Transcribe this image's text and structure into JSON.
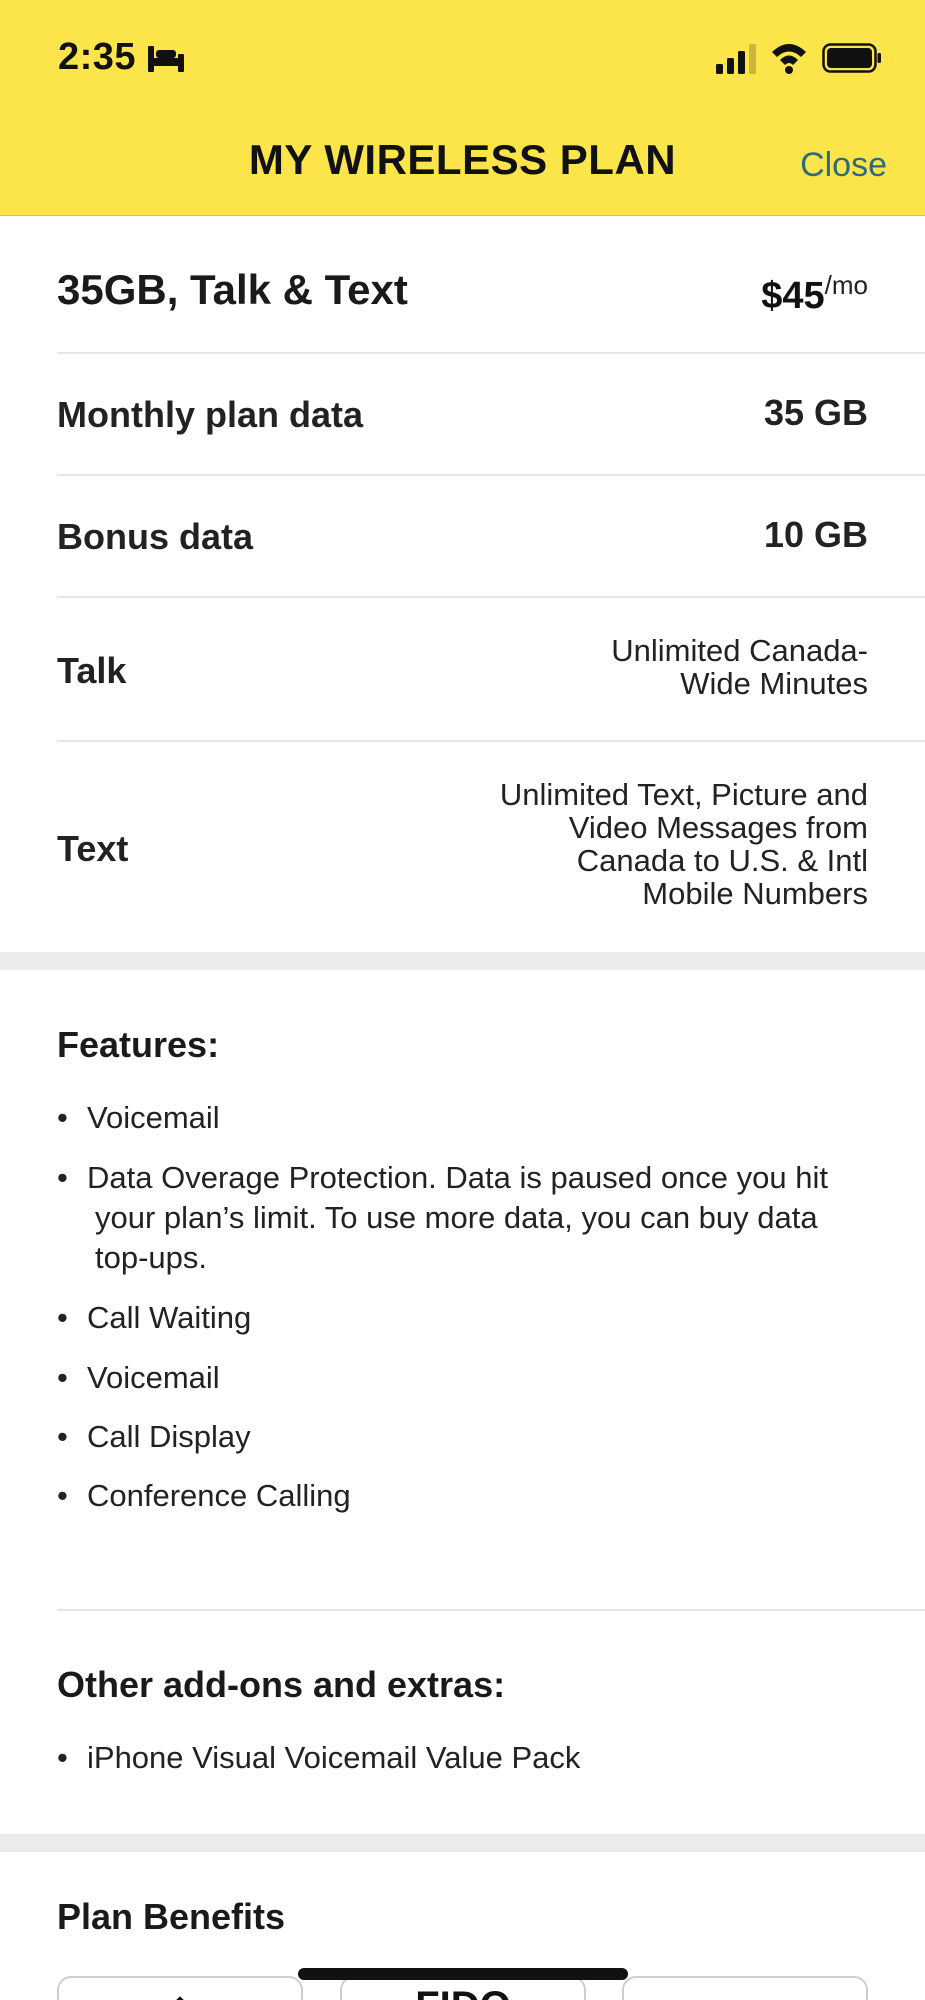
{
  "status_bar": {
    "time": "2:35"
  },
  "header": {
    "title": "MY WIRELESS PLAN",
    "close_label": "Close",
    "background_color": "#fbe54a",
    "accent_color": "#2e6b7a"
  },
  "plan": {
    "name": "35GB, Talk & Text",
    "price": "$45",
    "price_unit": "/mo",
    "rows": [
      {
        "label": "Monthly plan data",
        "value": "35 GB"
      },
      {
        "label": "Bonus data",
        "value": "10 GB"
      },
      {
        "label": "Talk",
        "value_lines": [
          "Unlimited Canada-",
          "Wide Minutes"
        ]
      },
      {
        "label": "Text",
        "value_lines": [
          "Unlimited Text, Picture and",
          "Video Messages from",
          "Canada to U.S. & Intl",
          "Mobile Numbers"
        ]
      }
    ]
  },
  "features": {
    "title": "Features:",
    "items": [
      "Voicemail",
      [
        "Data Overage Protection. Data is paused once you hit",
        "your plan’s limit. To use more data, you can buy data",
        "top-ups."
      ],
      "Call Waiting",
      "Voicemail",
      "Call Display",
      "Conference Calling"
    ]
  },
  "addons": {
    "title": "Other add-ons and extras:",
    "items": [
      "iPhone Visual Voicemail Value Pack"
    ]
  },
  "benefits": {
    "title": "Plan Benefits",
    "cards": [
      {
        "icon": "home-icon"
      },
      {
        "logo_text": "FIDO"
      },
      {
        "icon": ""
      }
    ]
  },
  "icons": {
    "status": [
      "bed-icon",
      "signal-icon",
      "wifi-icon",
      "battery-icon"
    ],
    "bullet": "•"
  }
}
